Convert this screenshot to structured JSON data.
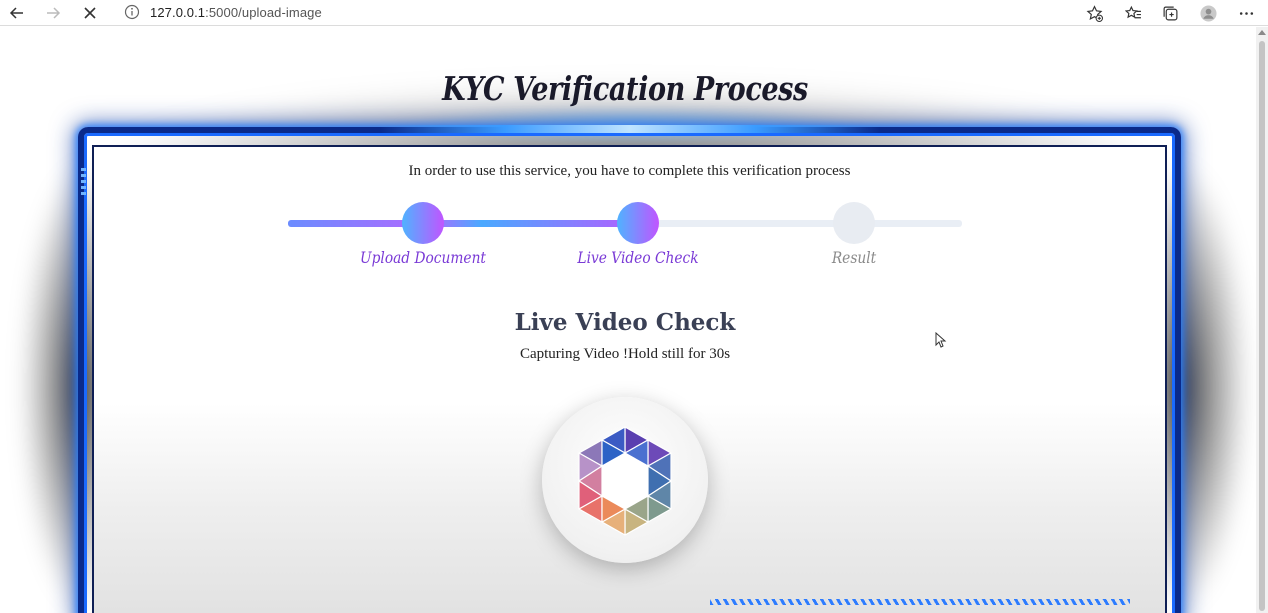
{
  "browser": {
    "url_host": "127.0.0.1",
    "url_path": ":5000/upload-image",
    "icons": {
      "back": "arrow-left-icon",
      "forward": "arrow-right-icon",
      "stop": "close-icon",
      "info": "info-icon",
      "add_favorite": "star-add-icon",
      "favorites": "favorites-icon",
      "collections": "collections-icon",
      "profile": "profile-avatar-icon",
      "more": "more-icon"
    }
  },
  "page": {
    "title": "KYC Verification Process",
    "intro": "In order to use this service, you have to complete this verification process",
    "steps": [
      {
        "label": "Upload Document",
        "state": "done"
      },
      {
        "label": "Live Video Check",
        "state": "active"
      },
      {
        "label": "Result",
        "state": "pending"
      }
    ],
    "section_title": "Live Video Check",
    "section_subtitle": "Capturing Video !Hold still for 30s",
    "loader_icon": "hexagon-spinner-icon"
  },
  "colors": {
    "frame_blue": "#0a2a8a",
    "accent_purple": "#7a3ad6",
    "step_gradient_start": "#4fb3ff",
    "step_gradient_end": "#c154ff",
    "pending_gray": "#e8ecf2"
  }
}
